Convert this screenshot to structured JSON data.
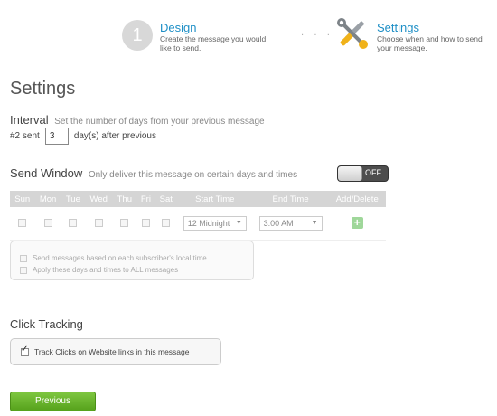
{
  "wizard": {
    "step1": {
      "number": "1",
      "title": "Design",
      "desc": "Create the message you would like to send."
    },
    "dots": "· · ·",
    "step2": {
      "title": "Settings",
      "desc": "Choose when and how to send your message.",
      "icon": "tools-icon"
    }
  },
  "page_title": "Settings",
  "interval": {
    "label": "Interval",
    "note": "Set the number of days from your previous message",
    "prefix": "#2 sent",
    "days": "3",
    "suffix": "day(s) after previous"
  },
  "send_window": {
    "label": "Send Window",
    "note": "Only deliver this message on certain days and times",
    "toggle_label": "OFF",
    "columns": [
      "Sun",
      "Mon",
      "Tue",
      "Wed",
      "Thu",
      "Fri",
      "Sat",
      "Start Time",
      "End Time",
      "Add/Delete"
    ],
    "start_time": "12 Midnight",
    "end_time": "3:00 AM",
    "add_label": "+",
    "options": [
      "Send messages based on each subscriber's local time",
      "Apply these days and times to ALL messages"
    ]
  },
  "click_tracking": {
    "label": "Click Tracking",
    "checkbox_label": "Track Clicks on Website links in this message",
    "checked": true
  },
  "buttons": {
    "previous": "Previous"
  },
  "colors": {
    "accent_blue": "#1e8fc6",
    "button_green": "#6cb82e",
    "add_green": "#9fd79a"
  }
}
